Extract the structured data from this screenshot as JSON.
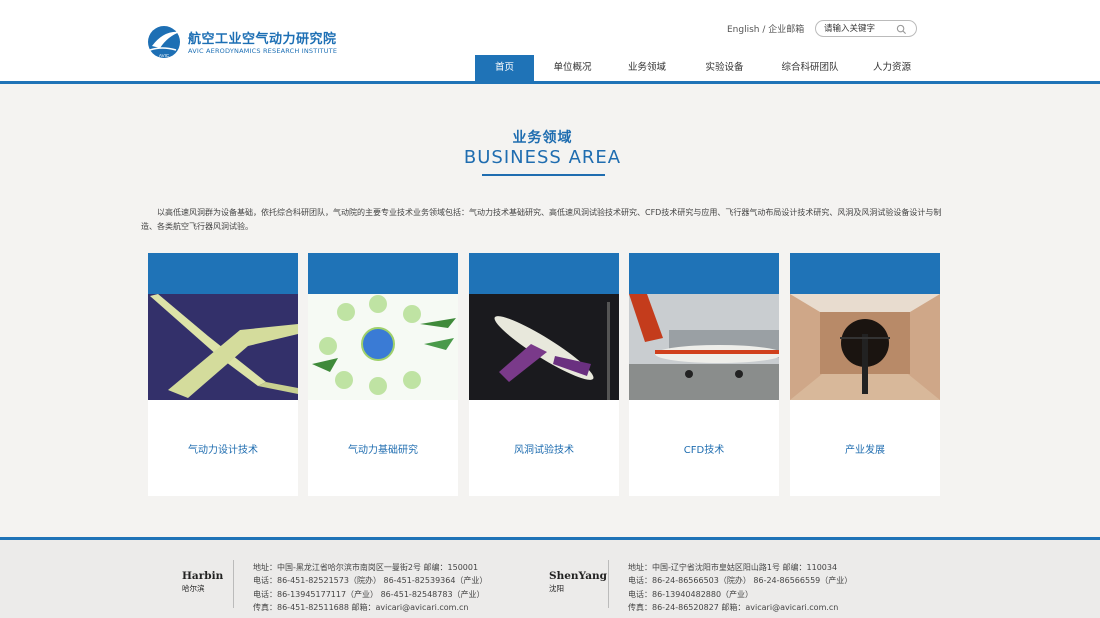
{
  "header": {
    "logo_cn": "航空工业空气动力研究院",
    "logo_en": "AVIC AERODYNAMICS RESEARCH INSTITUTE",
    "logo_mark_text": "AVIC",
    "link_english": "English",
    "link_sep": "/",
    "link_mail": "企业邮箱",
    "search_placeholder": "请输入关键字"
  },
  "nav": {
    "items": [
      {
        "label": "首页",
        "active": true
      },
      {
        "label": "单位概况",
        "active": false
      },
      {
        "label": "业务领域",
        "active": false
      },
      {
        "label": "实验设备",
        "active": false
      },
      {
        "label": "综合科研团队",
        "active": false
      },
      {
        "label": "人力资源",
        "active": false
      }
    ]
  },
  "section": {
    "title_cn": "业务领域",
    "title_en": "BUSINESS AREA",
    "intro": "以高低速风洞群为设备基础，依托综合科研团队，气动院的主要专业技术业务领域包括：气动力技术基础研究、高低速风洞试验技术研究、CFD技术研究与应用、飞行器气动布局设计技术研究、风洞及风洞试验设备设计与制造、各类航空飞行器风洞试验。"
  },
  "cards": [
    {
      "label": "气动力设计技术"
    },
    {
      "label": "气动力基础研究"
    },
    {
      "label": "风洞试验技术"
    },
    {
      "label": "CFD技术"
    },
    {
      "label": "产业发展"
    }
  ],
  "footer": {
    "harbin": {
      "city_en": "Harbin",
      "city_cn": "哈尔滨",
      "line1": "地址：中国-黑龙江省哈尔滨市南岗区一曼街2号  邮编：150001",
      "line2": "电话：86-451-82521573（院办）    86-451-82539364（产业）",
      "line3": "电话：86-13945177117（产业）    86-451-82548783（产业）",
      "line4": "传真：86-451-82511688    邮箱：avicari@avicari.com.cn"
    },
    "shenyang": {
      "city_en": "ShenYang",
      "city_cn": "沈阳",
      "line1": "地址：中国-辽宁省沈阳市皇姑区阳山路1号  邮编：110034",
      "line2": "电话：86-24-86566503（院办）    86-24-86566559（产业）",
      "line3": "电话：86-13940482880（产业）",
      "line4": "传真：86-24-86520827    邮箱：avicari@avicari.com.cn"
    }
  },
  "colors": {
    "brand_blue": "#1f73b7",
    "page_bg": "#f4f3f1",
    "footer_bg": "#ecebea"
  }
}
